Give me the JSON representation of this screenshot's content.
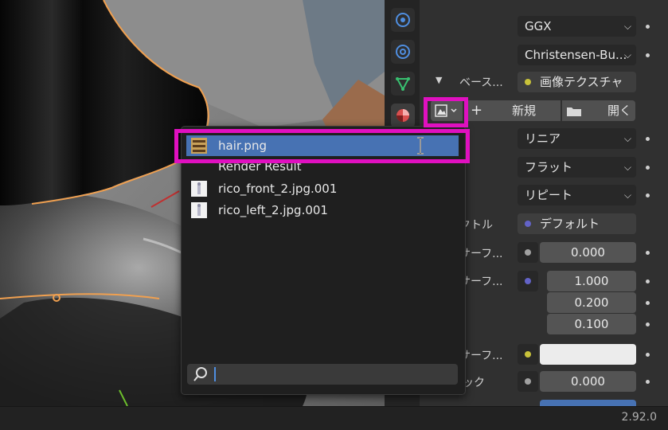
{
  "properties": {
    "distribution": "GGX",
    "subsurface_method": "Christensen-Bu...",
    "base_color_label": "ベース...",
    "base_color_link": "画像テクスチャ",
    "new_button": "新規",
    "open_button": "開く",
    "interpolation": "リニア",
    "projection": "フラット",
    "extension": "リピート",
    "vector_label": "クトル",
    "vector_value": "デフォルト",
    "subsurface_label": "サブサーフ...",
    "subsurface_value": "0.000",
    "subsurface_radius_label": "サブサーフ...",
    "subsurface_radius": [
      "1.000",
      "0.200",
      "0.100"
    ],
    "subsurface_color_label": "サブサーフ...",
    "metallic_label": "リック",
    "metallic_value": "0.000",
    "colors": {
      "socket_yellow": "#c8c23a",
      "socket_purple": "#6363c7",
      "socket_gray": "#a1a1a1",
      "highlight": "#e010c0",
      "selection": "#4772b3"
    }
  },
  "popup": {
    "items": [
      {
        "name": "hair.png",
        "icon": "hair-thumbnail",
        "selected": true
      },
      {
        "name": "Render Result",
        "icon": "none",
        "selected": false
      },
      {
        "name": "rico_front_2.jpg.001",
        "icon": "image-thumbnail",
        "selected": false
      },
      {
        "name": "rico_left_2.jpg.001",
        "icon": "image-thumbnail",
        "selected": false
      }
    ],
    "search_value": ""
  },
  "status": {
    "version": "2.92.0"
  }
}
